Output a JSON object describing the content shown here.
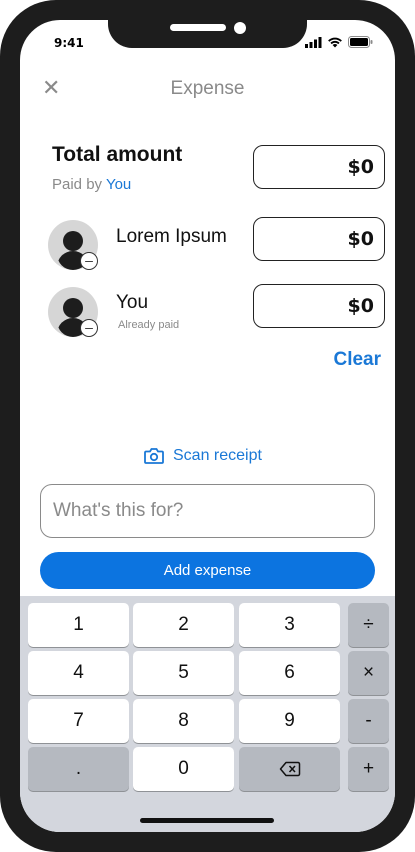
{
  "status_bar": {
    "time": "9:41"
  },
  "header": {
    "title": "Expense",
    "close_glyph": "✕"
  },
  "total": {
    "title": "Total amount",
    "paid_by_prefix": "Paid by",
    "paid_by_name": "You",
    "amount": "$0"
  },
  "people": [
    {
      "name": "Lorem Ipsum",
      "subtitle": "",
      "amount": "$0"
    },
    {
      "name": "You",
      "subtitle": "Already paid",
      "amount": "$0"
    }
  ],
  "clear_label": "Clear",
  "scan_receipt_label": "Scan receipt",
  "purpose_input": {
    "placeholder": "What's this for?",
    "value": ""
  },
  "add_button_label": "Add expense",
  "keypad": {
    "keys": [
      "1",
      "2",
      "3",
      "4",
      "5",
      "6",
      "7",
      "8",
      "9",
      ".",
      "0"
    ],
    "operators": [
      "÷",
      "×",
      "-",
      "+"
    ],
    "backspace_icon": "backspace-icon"
  },
  "colors": {
    "accent": "#0c74e0",
    "link": "#1a78d6",
    "keyboard_bg": "#d3d6dd"
  }
}
